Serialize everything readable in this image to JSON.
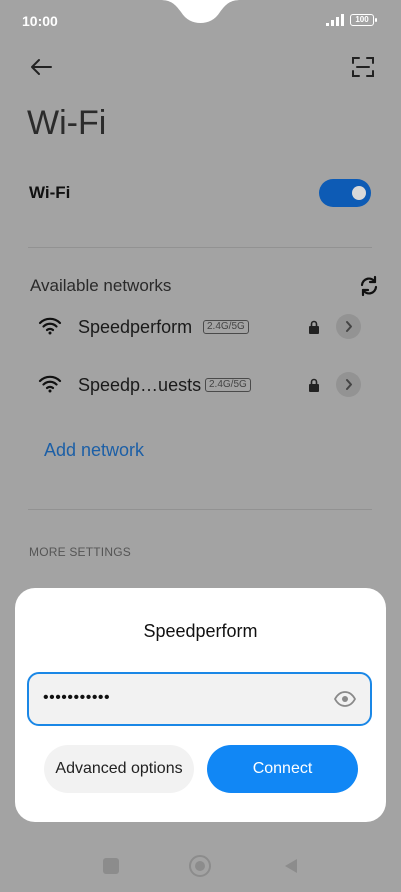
{
  "status_bar": {
    "time": "10:00",
    "battery": "100"
  },
  "page": {
    "title": "Wi-Fi"
  },
  "wifi_toggle": {
    "label": "Wi-Fi",
    "state": "on"
  },
  "available": {
    "title": "Available networks",
    "networks": [
      {
        "name": "Speedperform",
        "band": "2.4G/5G",
        "secured": true
      },
      {
        "name": "Speedp…uests",
        "band": "2.4G/5G",
        "secured": true
      }
    ],
    "add_label": "Add network"
  },
  "more_settings": "MORE SETTINGS",
  "dialog": {
    "title": "Speedperform",
    "password_value": "•••••••••••",
    "advanced_label": "Advanced options",
    "connect_label": "Connect"
  },
  "colors": {
    "accent": "#1187f5",
    "toggle_on": "#0d5bb5",
    "link": "#1c5fa6",
    "scrim": "#a3a3a3"
  },
  "icons": [
    "back-arrow-icon",
    "scan-icon",
    "refresh-icon",
    "wifi-signal-icon",
    "lock-icon",
    "chevron-right-icon",
    "eye-icon"
  ]
}
